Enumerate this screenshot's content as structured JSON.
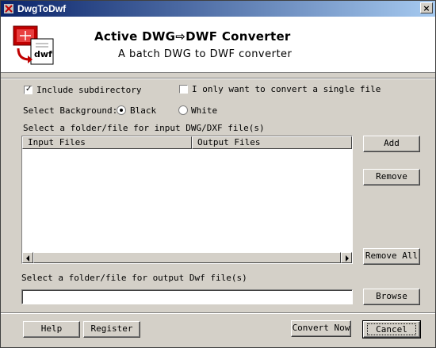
{
  "window": {
    "title": "DwgToDwf",
    "close_label": "×"
  },
  "banner": {
    "heading": "Active DWG⇨DWF Converter",
    "subheading": "A batch DWG to DWF converter",
    "logo_text": "dwf"
  },
  "options": {
    "include_subdirectory": {
      "label": "Include subdirectory",
      "checked": true
    },
    "single_file": {
      "label": "I only want to convert a single file",
      "checked": false
    },
    "background_label": "Select Background:",
    "black": {
      "label": "Black",
      "selected": true
    },
    "white": {
      "label": "White",
      "selected": false
    }
  },
  "input": {
    "label": "Select a folder/file for input DWG/DXF file(s)",
    "columns": [
      "Input Files",
      "Output Files"
    ],
    "rows": []
  },
  "buttons": {
    "add": "Add",
    "remove": "Remove",
    "remove_all": "Remove All",
    "browse": "Browse",
    "help": "Help",
    "register": "Register",
    "convert": "Convert Now",
    "cancel": "Cancel"
  },
  "output": {
    "label": "Select a folder/file for output Dwf file(s)",
    "value": ""
  }
}
